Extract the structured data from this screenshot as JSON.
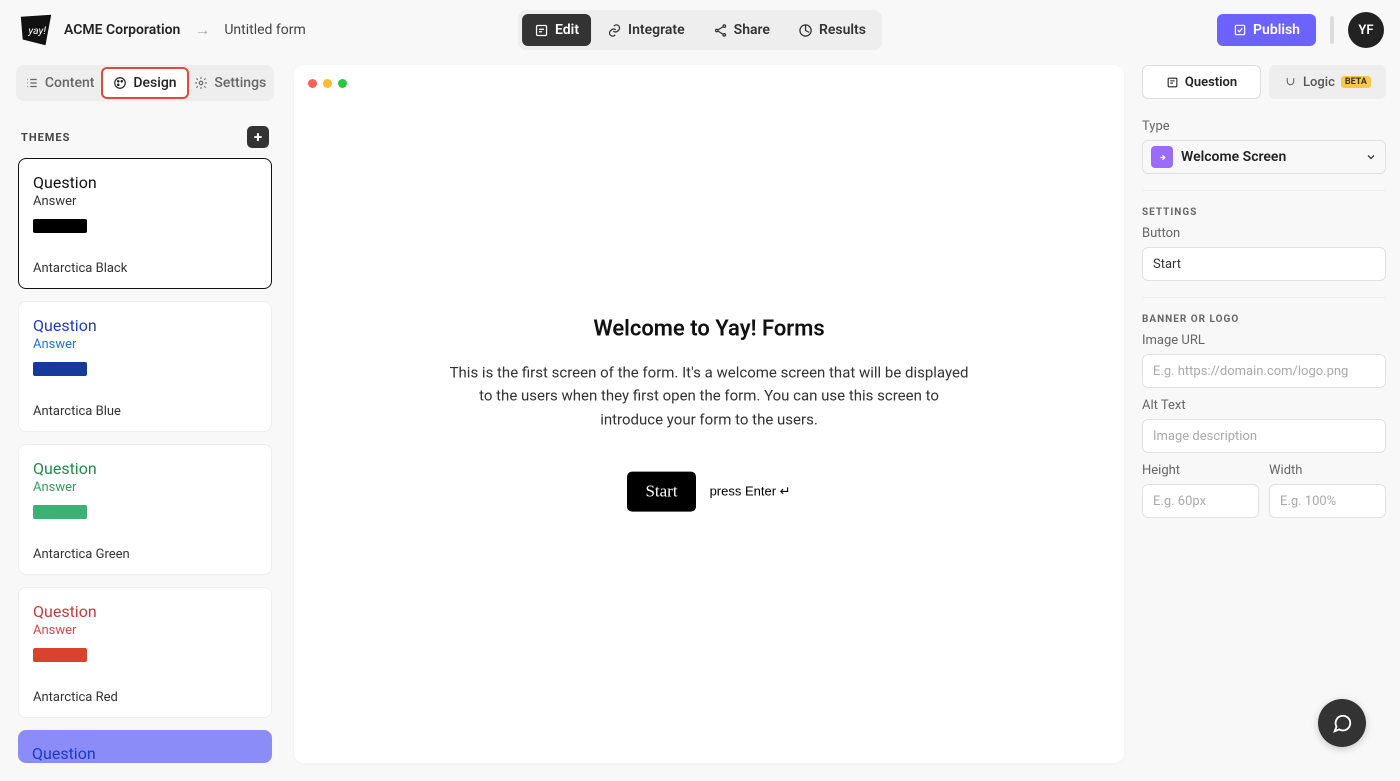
{
  "breadcrumb": {
    "org": "ACME Corporation",
    "form": "Untitled form"
  },
  "toolbar": {
    "edit": "Edit",
    "integrate": "Integrate",
    "share": "Share",
    "results": "Results",
    "publish": "Publish"
  },
  "avatar": "YF",
  "left_tabs": {
    "content": "Content",
    "design": "Design",
    "settings": "Settings"
  },
  "themes": {
    "heading": "THEMES",
    "question_word": "Question",
    "answer_word": "Answer",
    "items": [
      {
        "name": "Antarctica Black",
        "q_color": "#111111",
        "a_color": "#333333",
        "swatch": "#000000",
        "selected": true
      },
      {
        "name": "Antarctica Blue",
        "q_color": "#1d3bbf",
        "a_color": "#1d6ff2",
        "swatch": "#143a9a"
      },
      {
        "name": "Antarctica Green",
        "q_color": "#1f8a4c",
        "a_color": "#2aa35d",
        "swatch": "#3bb273"
      },
      {
        "name": "Antarctica Red",
        "q_color": "#c43b3b",
        "a_color": "#d24a4a",
        "swatch": "#d9432e"
      }
    ],
    "partial_item": {
      "q_color": "#1d3bbf"
    }
  },
  "preview": {
    "title": "Welcome to Yay! Forms",
    "description": "This is the first screen of the form. It's a welcome screen that will be displayed to the users when they first open the form. You can use this screen to introduce your form to the users.",
    "start": "Start",
    "hint": "press Enter ↵"
  },
  "right_tabs": {
    "question": "Question",
    "logic": "Logic",
    "beta": "BETA"
  },
  "right_panel": {
    "type_label": "Type",
    "type_value": "Welcome Screen",
    "settings_heading": "SETTINGS",
    "button_label": "Button",
    "button_value": "Start",
    "banner_heading": "BANNER OR LOGO",
    "image_url_label": "Image URL",
    "image_url_placeholder": "E.g. https://domain.com/logo.png",
    "alt_label": "Alt Text",
    "alt_placeholder": "Image description",
    "height_label": "Height",
    "height_placeholder": "E.g. 60px",
    "width_label": "Width",
    "width_placeholder": "E.g. 100%"
  }
}
